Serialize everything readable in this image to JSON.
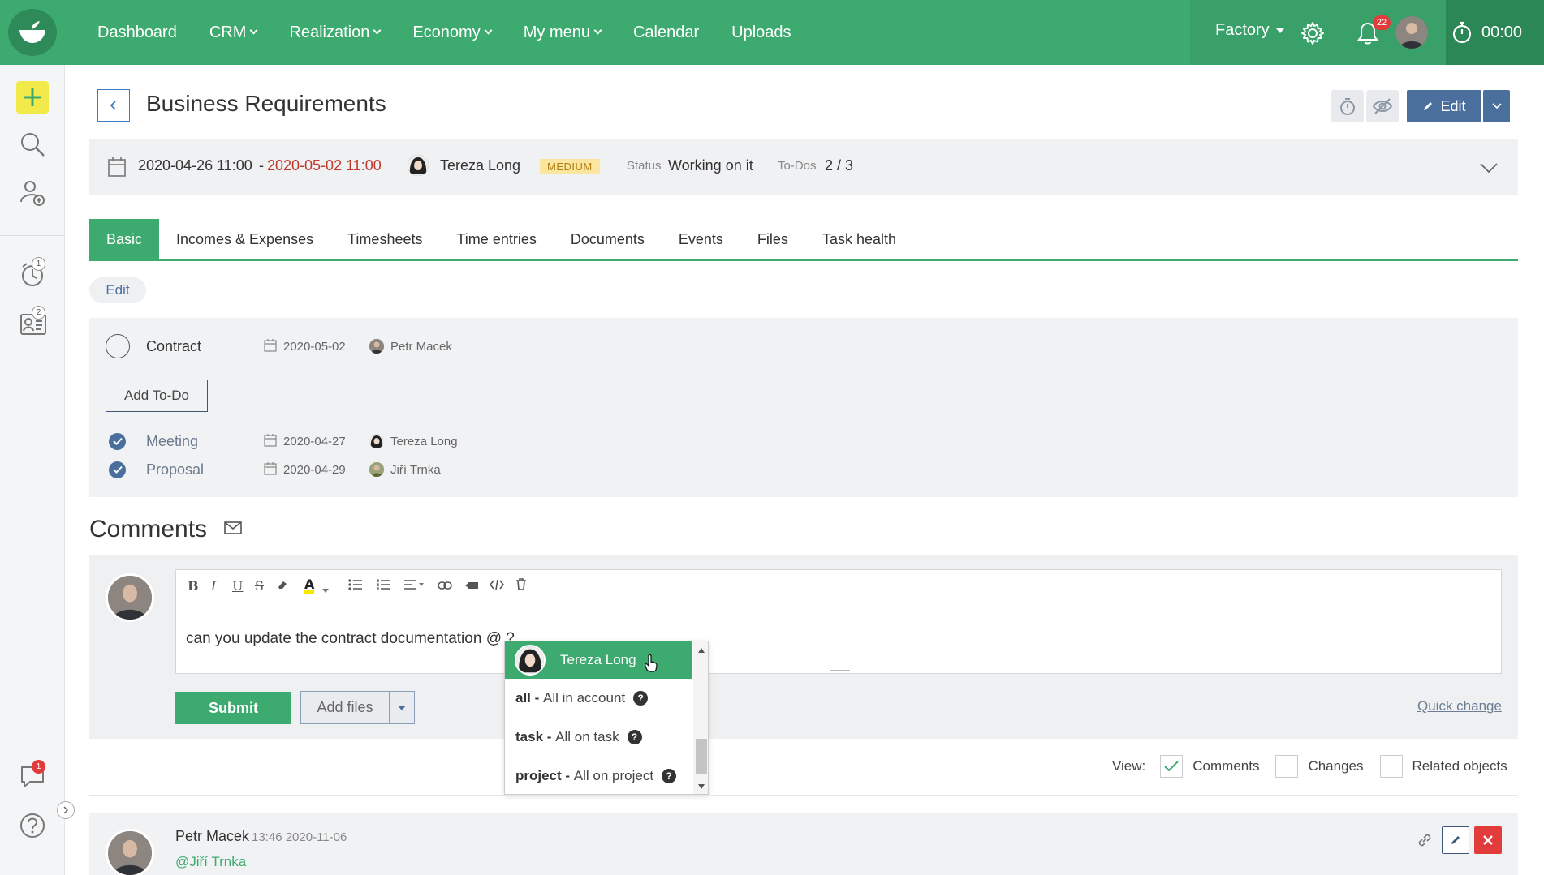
{
  "nav": {
    "items": [
      {
        "label": "Dashboard",
        "dropdown": false
      },
      {
        "label": "CRM",
        "dropdown": true
      },
      {
        "label": "Realization",
        "dropdown": true
      },
      {
        "label": "Economy",
        "dropdown": true
      },
      {
        "label": "My menu",
        "dropdown": true
      },
      {
        "label": "Calendar",
        "dropdown": false
      },
      {
        "label": "Uploads",
        "dropdown": false
      }
    ],
    "company": "Factory",
    "notifications_count": "22",
    "timer": "00:00"
  },
  "sidebar": {
    "reminders_badge": "1",
    "contacts_badge": "2",
    "chat_badge": "1"
  },
  "header": {
    "title": "Business Requirements",
    "edit_label": "Edit"
  },
  "info": {
    "start": "2020-04-26 11:00",
    "separator": "-",
    "end": "2020-05-02 11:00",
    "assignee": "Tereza Long",
    "priority": "MEDIUM",
    "status_label": "Status",
    "status_value": "Working on it",
    "todos_label": "To-Dos",
    "todos_value": "2 / 3"
  },
  "tabs": [
    "Basic",
    "Incomes & Expenses",
    "Timesheets",
    "Time entries",
    "Documents",
    "Events",
    "Files",
    "Task health"
  ],
  "edit_pill": "Edit",
  "todos": {
    "open": {
      "title": "Contract",
      "date": "2020-05-02",
      "user": "Petr Macek"
    },
    "add_label": "Add To-Do",
    "done": [
      {
        "title": "Meeting",
        "date": "2020-04-27",
        "user": "Tereza Long"
      },
      {
        "title": "Proposal",
        "date": "2020-04-29",
        "user": "Jiří Trnka"
      }
    ]
  },
  "comments": {
    "title": "Comments",
    "draft_text": "can you update the contract documentation @ ?",
    "submit_label": "Submit",
    "add_files_label": "Add files",
    "quick_change": "Quick change",
    "mention_options": {
      "selected": "Tereza Long",
      "items": [
        {
          "key": "all -",
          "desc": "All in account"
        },
        {
          "key": "task -",
          "desc": "All on task"
        },
        {
          "key": "project -",
          "desc": "All on project"
        }
      ]
    },
    "view": {
      "label": "View:",
      "options": [
        {
          "label": "Comments",
          "checked": true
        },
        {
          "label": "Changes",
          "checked": false
        },
        {
          "label": "Related objects",
          "checked": false
        }
      ]
    },
    "post": {
      "author": "Petr Macek",
      "time": "13:46 2020-11-06",
      "mention": "@Jiří Trnka"
    }
  },
  "colors": {
    "brand": "#3daa6f",
    "accent_blue": "#4a6f9d",
    "danger": "#e23b3b",
    "due_red": "#c0392b"
  }
}
